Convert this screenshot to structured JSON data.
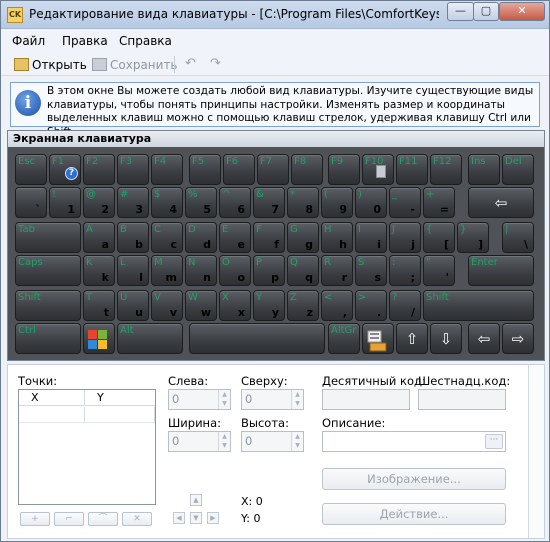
{
  "window": {
    "title": "Редактирование вида клавиатуры - [C:\\Program Files\\ComfortKeys\\Keybo...",
    "app_icon_text": "CK",
    "minimize": "—",
    "maximize": "▢",
    "close": "✕"
  },
  "menu": {
    "file": "Файл",
    "edit": "Правка",
    "help": "Справка"
  },
  "toolbar": {
    "open": "Открыть",
    "save": "Сохранить",
    "undo": "↶",
    "redo": "↷"
  },
  "info": {
    "icon": "i",
    "text": "В этом окне Вы можете создать любой вид клавиатуры. Изучите существующие виды клавиатуры, чтобы понять принципы настройки. Изменять размер и координаты выделенных клавиш можно с помощью клавиш стрелок, удерживая клавишу Ctrl или Shift."
  },
  "keyboard": {
    "title": "Экранная клавиатура",
    "rows": [
      [
        {
          "l": "Esc",
          "r": ""
        },
        {
          "l": "F1",
          "r": "",
          "badge": "help"
        },
        {
          "l": "F2",
          "r": ""
        },
        {
          "l": "F3",
          "r": ""
        },
        {
          "l": "F4",
          "r": ""
        },
        {
          "l": "F5",
          "r": ""
        },
        {
          "l": "F6",
          "r": ""
        },
        {
          "l": "F7",
          "r": ""
        },
        {
          "l": "F8",
          "r": ""
        },
        {
          "l": "F9",
          "r": ""
        },
        {
          "l": "F10",
          "r": "",
          "badge": "calc"
        },
        {
          "l": "F11",
          "r": ""
        },
        {
          "l": "F12",
          "r": ""
        },
        {
          "l": "Ins",
          "r": ""
        },
        {
          "l": "Del",
          "r": ""
        }
      ],
      [
        {
          "l": "",
          "r": "`"
        },
        {
          "l": "!",
          "r": "1"
        },
        {
          "l": "@",
          "r": "2"
        },
        {
          "l": "#",
          "r": "3"
        },
        {
          "l": "$",
          "r": "4"
        },
        {
          "l": "%",
          "r": "5"
        },
        {
          "l": "^",
          "r": "6"
        },
        {
          "l": "&",
          "r": "7"
        },
        {
          "l": "*",
          "r": "8"
        },
        {
          "l": "(",
          "r": "9"
        },
        {
          "l": ")",
          "r": "0"
        },
        {
          "l": "_",
          "r": "-"
        },
        {
          "l": "+",
          "r": "="
        },
        {
          "l": "",
          "r": "",
          "c": "⇦"
        }
      ],
      [
        {
          "l": "Tab",
          "r": ""
        },
        {
          "l": "A",
          "r": "a"
        },
        {
          "l": "B",
          "r": "b"
        },
        {
          "l": "C",
          "r": "c"
        },
        {
          "l": "D",
          "r": "d"
        },
        {
          "l": "E",
          "r": "e"
        },
        {
          "l": "F",
          "r": "f"
        },
        {
          "l": "G",
          "r": "g"
        },
        {
          "l": "H",
          "r": "h"
        },
        {
          "l": "I",
          "r": "i"
        },
        {
          "l": "J",
          "r": "j"
        },
        {
          "l": "{",
          "r": "["
        },
        {
          "l": "}",
          "r": "]"
        },
        {
          "l": "|",
          "r": "\\"
        }
      ],
      [
        {
          "l": "Caps",
          "r": ""
        },
        {
          "l": "K",
          "r": "k"
        },
        {
          "l": "L",
          "r": "l"
        },
        {
          "l": "M",
          "r": "m"
        },
        {
          "l": "N",
          "r": "n"
        },
        {
          "l": "O",
          "r": "o"
        },
        {
          "l": "P",
          "r": "p"
        },
        {
          "l": "Q",
          "r": "q"
        },
        {
          "l": "R",
          "r": "r"
        },
        {
          "l": "S",
          "r": "s"
        },
        {
          "l": ":",
          "r": ";"
        },
        {
          "l": "\"",
          "r": "'"
        },
        {
          "l": "Enter",
          "r": ""
        }
      ],
      [
        {
          "l": "Shift",
          "r": ""
        },
        {
          "l": "T",
          "r": "t"
        },
        {
          "l": "U",
          "r": "u"
        },
        {
          "l": "V",
          "r": "v"
        },
        {
          "l": "W",
          "r": "w"
        },
        {
          "l": "X",
          "r": "x"
        },
        {
          "l": "Y",
          "r": "y"
        },
        {
          "l": "Z",
          "r": "z"
        },
        {
          "l": "<",
          "r": ","
        },
        {
          "l": ">",
          "r": "."
        },
        {
          "l": "?",
          "r": "/"
        },
        {
          "l": "Shift",
          "r": ""
        }
      ],
      [
        {
          "l": "Ctrl",
          "r": ""
        },
        {
          "l": "",
          "r": "",
          "icon": "windows"
        },
        {
          "l": "Alt",
          "r": ""
        },
        {
          "l": "",
          "r": ""
        },
        {
          "l": "AltGr",
          "r": ""
        },
        {
          "l": "",
          "r": "",
          "icon": "keyboard"
        },
        {
          "l": "",
          "r": "",
          "c": "⇧"
        },
        {
          "l": "",
          "r": "",
          "c": "⇩"
        },
        {
          "l": "",
          "r": "",
          "c": "⇦"
        },
        {
          "l": "",
          "r": "",
          "c": "⇨"
        }
      ]
    ]
  },
  "bottom": {
    "points_label": "Точки:",
    "col_x": "X",
    "col_y": "Y",
    "left_label": "Слева:",
    "left_value": "0",
    "top_label": "Сверху:",
    "top_value": "0",
    "width_label": "Ширина:",
    "width_value": "0",
    "height_label": "Высота:",
    "height_value": "0",
    "dec_code_label": "Десятичный код:",
    "hex_code_label": "Шестнадц.код:",
    "description_label": "Описание:",
    "ellipsis": "···",
    "image_button": "Изображение...",
    "action_button": "Действие...",
    "x_readout": "X: 0",
    "y_readout": "Y: 0",
    "mini_buttons": [
      "+",
      "⌐",
      "⌒",
      "✕"
    ],
    "nav": {
      "up": "▲",
      "down": "▼",
      "left": "◀",
      "right": "▶",
      "center": "●"
    }
  }
}
